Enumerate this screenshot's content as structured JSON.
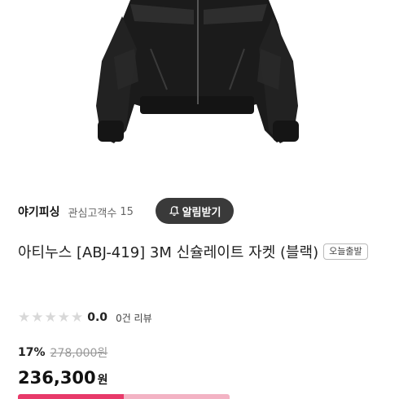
{
  "seller": {
    "name": "야기피싱",
    "follower_label": "관심고객수",
    "follower_count": "15",
    "alert_button": "알림받기"
  },
  "product": {
    "title": "아티누스 [ABJ-419] 3M 신슐레이트 자켓 (블랙)",
    "badge": "오늘출발"
  },
  "rating": {
    "value": "0.0",
    "stars_filled": 0,
    "stars_total": 5,
    "review_text": "0건 리뷰"
  },
  "pricing": {
    "discount_rate": "17%",
    "original_price": "278,000원",
    "price": "236,300",
    "currency": "원"
  },
  "colors": {
    "accent_pink": "#e83a6a",
    "button_dark": "#3a3a3a"
  },
  "icons": {
    "alert": "bell-plus-icon",
    "star": "star-icon"
  }
}
